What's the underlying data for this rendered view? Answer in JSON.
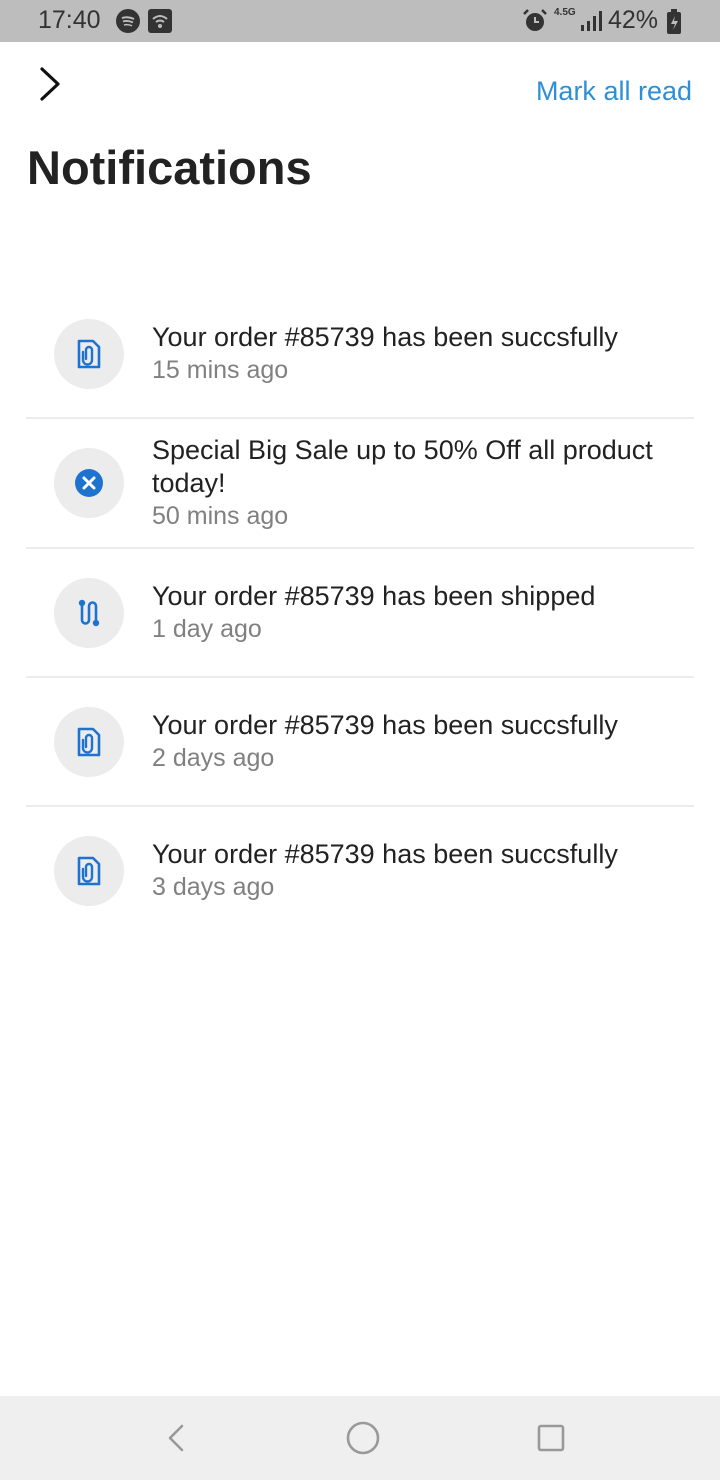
{
  "status_bar": {
    "time": "17:40",
    "network": "4.5G",
    "battery": "42%",
    "icons": [
      "spotify-icon",
      "wifi-icon",
      "alarm-icon",
      "signal-icon",
      "battery-icon"
    ]
  },
  "header": {
    "mark_all_read": "Mark all read",
    "title": "Notifications"
  },
  "colors": {
    "accent": "#2d8fd5",
    "icon_blue": "#1e73d1",
    "icon_bg": "#ececec"
  },
  "notifications": [
    {
      "icon": "order-paperclip-icon",
      "title": "Your order #85739 has been succsfully",
      "time": "15 mins ago"
    },
    {
      "icon": "cancel-circle-icon",
      "title": "Special Big Sale up to 50% Off all product today!",
      "time": "50 mins ago"
    },
    {
      "icon": "shipping-route-icon",
      "title": "Your order #85739 has been shipped",
      "time": "1 day ago"
    },
    {
      "icon": "order-paperclip-icon",
      "title": "Your order #85739 has been succsfully",
      "time": "2 days ago"
    },
    {
      "icon": "order-paperclip-icon",
      "title": "Your order #85739 has been succsfully",
      "time": "3 days ago"
    }
  ]
}
